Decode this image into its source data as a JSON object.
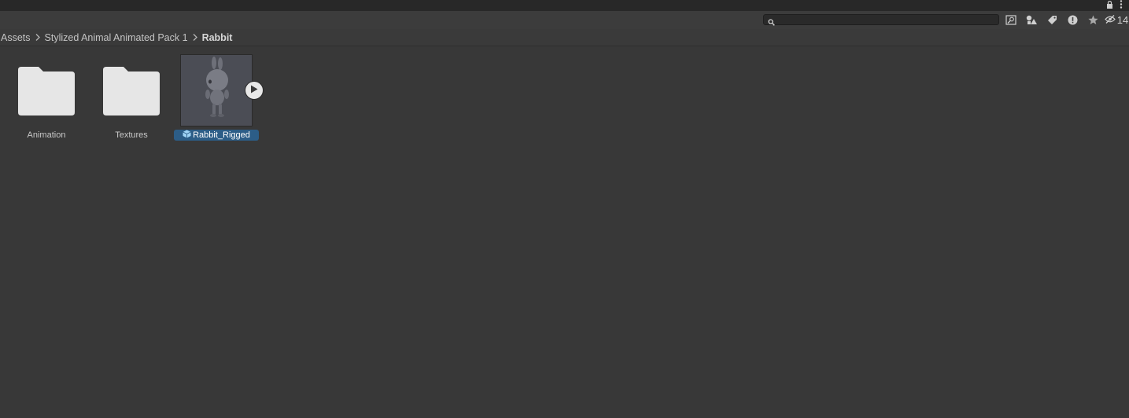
{
  "toolbar": {
    "search_placeholder": "",
    "hidden_packages_count": "14",
    "icons": [
      "lock-icon",
      "more-icon",
      "search-icon",
      "scene-search-icon",
      "type-filter-icon",
      "label-filter-icon",
      "log-filter-icon",
      "favorite-icon",
      "hidden-packages-icon"
    ]
  },
  "breadcrumb": {
    "items": [
      "Assets",
      "Stylized Animal Animated Pack 1",
      "Rabbit"
    ]
  },
  "assets": [
    {
      "label": "Animation",
      "kind": "folder"
    },
    {
      "label": "Textures",
      "kind": "folder"
    },
    {
      "label": "Rabbit_Rigged",
      "kind": "model",
      "selected": true
    }
  ],
  "colors": {
    "background": "#383838",
    "selection": "#2c5d87",
    "folder": "#e6e6e6"
  }
}
